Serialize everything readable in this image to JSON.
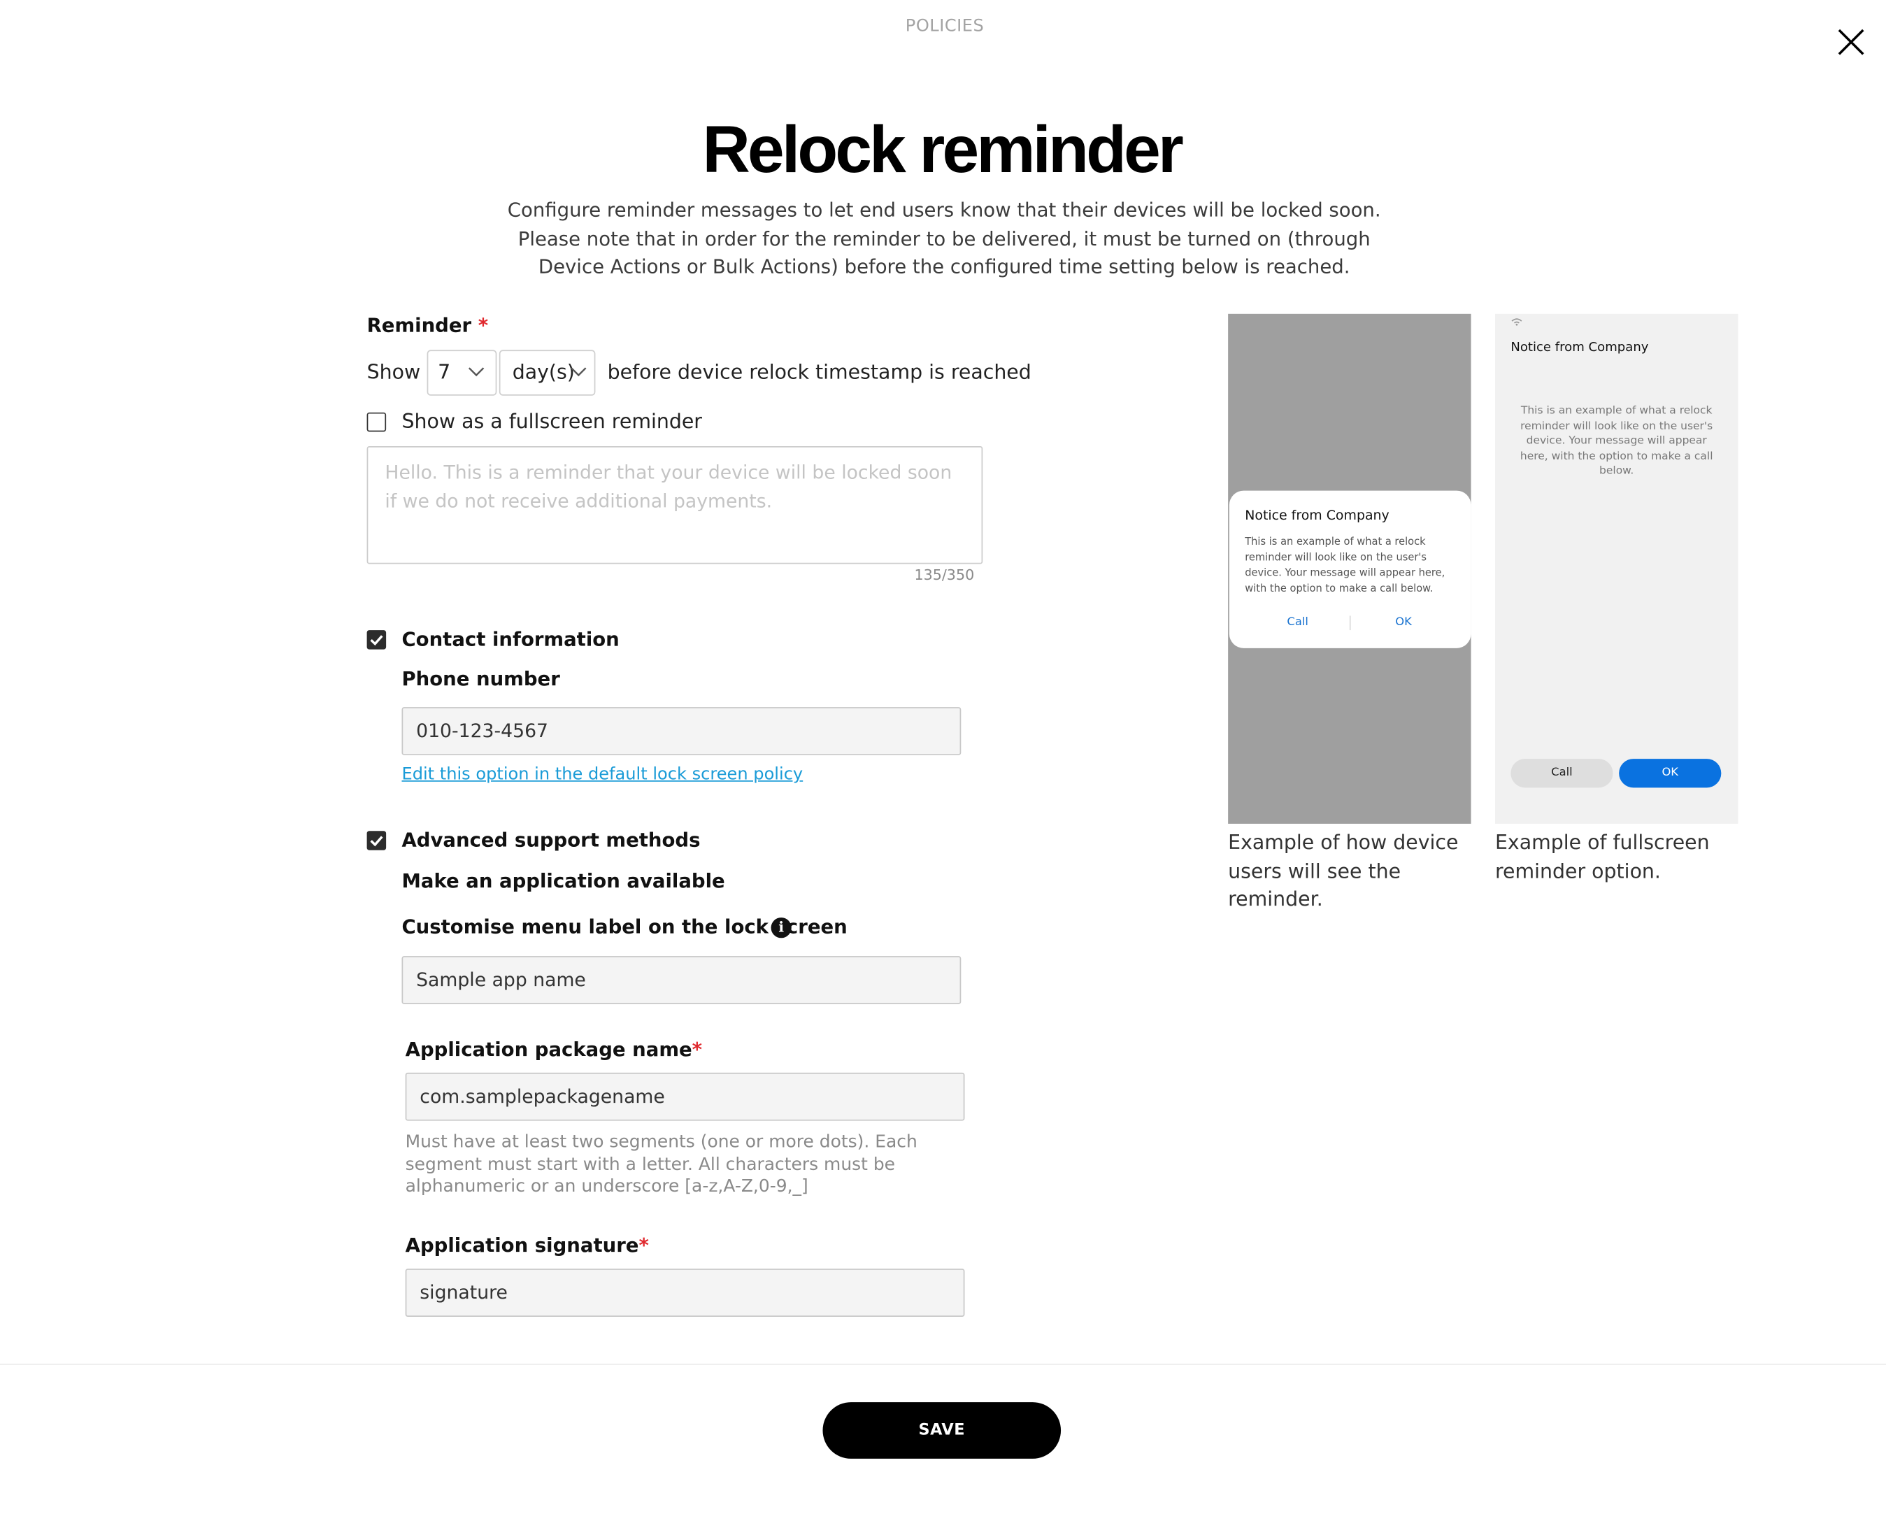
{
  "header": {
    "section_label": "POLICIES"
  },
  "page": {
    "title": "Relock reminder",
    "description": "Configure reminder messages to let end users know that their devices will be locked soon. Please note that in order for the reminder to be delivered, it must be turned on (through Device Actions or Bulk Actions) before the configured time setting below is reached."
  },
  "reminder": {
    "label": "Reminder",
    "required_mark": "*",
    "show_label": "Show",
    "count_value": "7",
    "unit_value": "day(s)",
    "suffix_text": "before device relock timestamp is reached",
    "fullscreen_label": "Show as a fullscreen reminder",
    "fullscreen_checked": false,
    "message_placeholder": "Hello. This is a reminder that your device will be locked soon if we do not receive additional payments.",
    "char_counter": "135/350"
  },
  "contact": {
    "checkbox_label": "Contact information",
    "checked": true,
    "phone_label": "Phone number",
    "phone_value": "010-123-4567",
    "edit_link": "Edit this option in the default lock screen policy"
  },
  "advanced": {
    "checkbox_label": "Advanced support methods",
    "checked": true,
    "app_available_label": "Make an application available",
    "menu_label_label": "Customise menu label on the lock screen",
    "menu_label_value": "Sample app name",
    "package_label": "Application package name",
    "package_value": "com.samplepackagename",
    "package_helper": "Must have at least two segments (one or more dots). Each segment must start with a letter. All characters must be alphanumeric or an underscore [a-z,A-Z,0-9,_]",
    "signature_label": "Application signature",
    "signature_value": "signature"
  },
  "preview": {
    "dialog_title": "Notice from Company",
    "dialog_body": "This is an example of what a relock reminder will look like on the user's device. Your message will appear here, with the option to make a call below.",
    "call_label": "Call",
    "ok_label": "OK",
    "caption_dialog": "Example of how device users will see the reminder.",
    "full_title": "Notice from Company",
    "full_body": "This is an example of what a relock reminder will look like on the user's device. Your message will appear here, with the option to make a call below.",
    "full_call_label": "Call",
    "full_ok_label": "OK",
    "caption_full": "Example of fullscreen reminder option."
  },
  "footer": {
    "save_label": "SAVE"
  },
  "colors": {
    "accent_blue": "#0a72e0",
    "required_red": "#e0292e",
    "link_blue": "#1a9bd7"
  },
  "icons": {
    "close": "close-icon",
    "chevron": "chevron-down-icon",
    "check": "check-icon",
    "info": "info-icon",
    "wifi": "wifi-icon"
  }
}
